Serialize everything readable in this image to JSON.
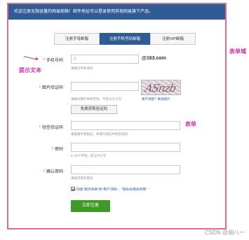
{
  "banner": {
    "text": "欢迎注册无限容量的网易邮箱！邮件地址可以登录使用其他网易旗下产品。"
  },
  "tabs": [
    {
      "label": "注册字母邮箱",
      "active": false
    },
    {
      "label": "注册手机号码邮箱",
      "active": true
    },
    {
      "label": "注册VIP邮箱",
      "active": false
    }
  ],
  "fields": {
    "phone": {
      "label": "手机号码",
      "value": "",
      "placeholder": "",
      "suffix": "@163.com",
      "hint": "请填写手机号码"
    },
    "captcha": {
      "label": "图片验证码",
      "value": "",
      "hint": "请填写图片中的字符，不区分大小写",
      "image_text": "ASnzb",
      "refresh_text": "看不清楚？换张图片",
      "get_code_button": "免费获取验证码"
    },
    "sms_code": {
      "label": "短信验证码",
      "value": "",
      "hint": "请查收手机短信，并填写短信中的验证码"
    },
    "password": {
      "label": "密码",
      "value": "",
      "hint": "6~16个字符，区分大小写"
    },
    "confirm_password": {
      "label": "确认密码",
      "value": "",
      "hint": "请再次填写密码"
    }
  },
  "agreement": {
    "prefix": "同意",
    "terms": "“服务条款”",
    "and": "和",
    "privacy1": "“用户须知”",
    "sep": "、",
    "privacy2": "“隐私权相关政策”",
    "checked": true
  },
  "submit_button": "立即注册",
  "annotations": {
    "hint_text": "提示文本",
    "form": "表单",
    "form_domain": "表单域"
  },
  "watermark": "CSDN @胡八一",
  "colors": {
    "accent_blue": "#2f5c95",
    "annotation": "#cc2fae",
    "frame": "#e06a8a",
    "submit_green": "#3e9a26"
  }
}
